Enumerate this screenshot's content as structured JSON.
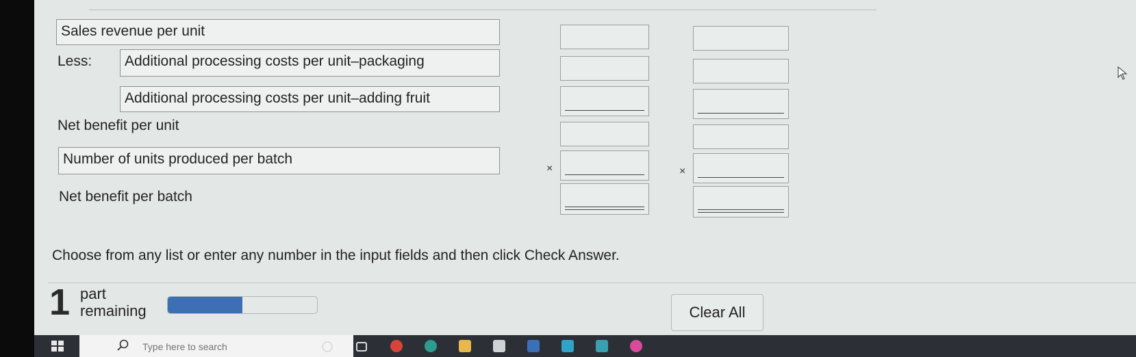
{
  "rows": {
    "sales_revenue": "Sales revenue per unit",
    "less_label": "Less:",
    "packaging_cost": "Additional processing costs per unit–packaging",
    "fruit_cost": "Additional processing costs per unit–adding fruit",
    "net_benefit_unit": "Net benefit per unit",
    "units_per_batch": "Number of units produced per batch",
    "net_benefit_batch": "Net benefit per batch"
  },
  "multiply_sign": "×",
  "instruction": "Choose from any list or enter any number in the input fields and then click Check Answer.",
  "progress": {
    "number": "1",
    "line1": "part",
    "line2": "remaining",
    "fill_fraction": 0.5
  },
  "buttons": {
    "clear_all": "Clear All"
  },
  "taskbar": {
    "search_placeholder": "Type here to search"
  },
  "icons": [
    "windows-start-icon",
    "search-icon",
    "cortana-icon",
    "task-view-icon",
    "chrome-icon",
    "edge-icon",
    "file-explorer-icon",
    "store-icon",
    "mail-icon",
    "app-icon",
    "teams-icon",
    "photos-icon",
    "chat-icon"
  ],
  "colors": {
    "progress_fill": "#3d6fb4",
    "screen_bg": "#e3e7e6",
    "taskbar_bg": "#2c3036"
  }
}
